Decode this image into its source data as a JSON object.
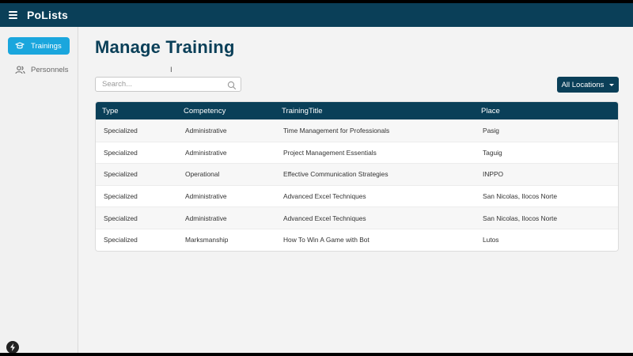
{
  "app": {
    "title": "PoLists"
  },
  "sidebar": {
    "items": [
      {
        "label": "Trainings",
        "icon": "trainings-icon",
        "active": true
      },
      {
        "label": "Personnels",
        "icon": "users-icon",
        "active": false
      }
    ]
  },
  "main": {
    "title": "Manage Training",
    "search": {
      "placeholder": "Search...",
      "value": ""
    },
    "location_filter": {
      "label": "All Locations"
    }
  },
  "table": {
    "columns": [
      "Type",
      "Competency",
      "TrainingTitle",
      "Place"
    ],
    "rows": [
      [
        "Specialized",
        "Administrative",
        "Time Management for Professionals",
        "Pasig"
      ],
      [
        "Specialized",
        "Administrative",
        "Project Management Essentials",
        "Taguig"
      ],
      [
        "Specialized",
        "Operational",
        "Effective Communication Strategies",
        "INPPO"
      ],
      [
        "Specialized",
        "Administrative",
        "Advanced Excel Techniques",
        "San Nicolas, Ilocos Norte"
      ],
      [
        "Specialized",
        "Administrative",
        "Advanced Excel Techniques",
        "San Nicolas, Ilocos Norte"
      ],
      [
        "Specialized",
        "Marksmanship",
        "How To Win A Game with Bot",
        "Lutos"
      ]
    ]
  },
  "colors": {
    "primary": "#0a3f58",
    "accent": "#1aa6dd",
    "background": "#f3f3f3"
  }
}
